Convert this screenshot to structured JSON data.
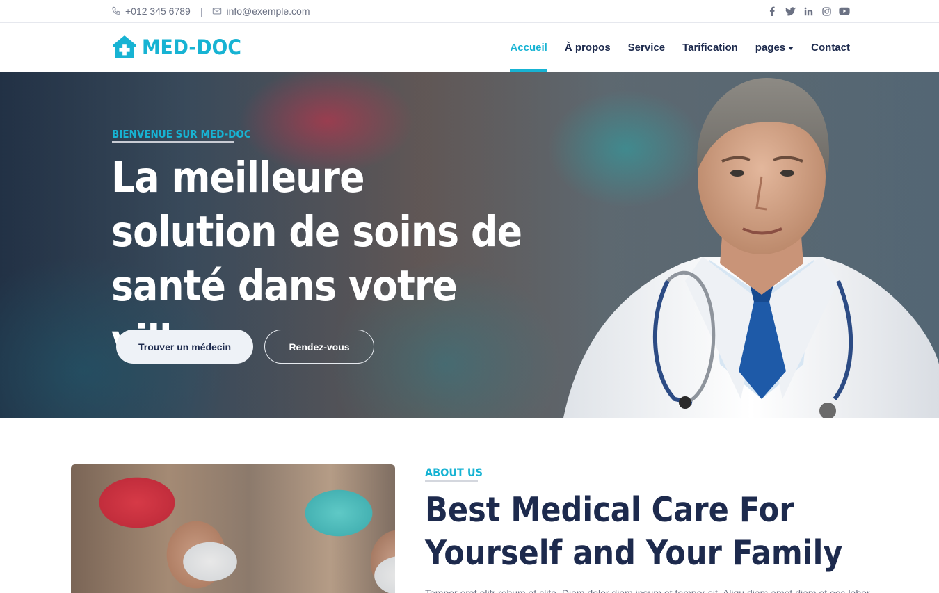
{
  "topbar": {
    "phone": "+012 345 6789",
    "separator": "|",
    "email": "info@exemple.com",
    "social_icons": [
      "facebook-icon",
      "twitter-icon",
      "linkedin-icon",
      "instagram-icon",
      "youtube-icon"
    ]
  },
  "brand": {
    "name": "MED-DOC",
    "color": "#17b3d3"
  },
  "nav": {
    "items": [
      {
        "label": "Accueil",
        "active": true
      },
      {
        "label": "À propos"
      },
      {
        "label": "Service"
      },
      {
        "label": "Tarification"
      },
      {
        "label": "pages",
        "dropdown": true
      },
      {
        "label": "Contact"
      }
    ]
  },
  "hero": {
    "eyebrow": "BIENVENUE SUR MED-DOC",
    "headline": "La meilleure solution de soins de santé dans votre ville",
    "primary_button": "Trouver un médecin",
    "secondary_button": "Rendez-vous"
  },
  "about": {
    "eyebrow": "ABOUT US",
    "title": "Best Medical Care For Yourself and Your Family",
    "text": "Tempor erat elitr rebum at clita. Diam dolor diam ipsum et tempor sit. Aliqu diam amet diam et eos labore."
  },
  "colors": {
    "accent": "#17b3d3",
    "heading": "#1d2a4d",
    "muted": "#6b7183"
  }
}
